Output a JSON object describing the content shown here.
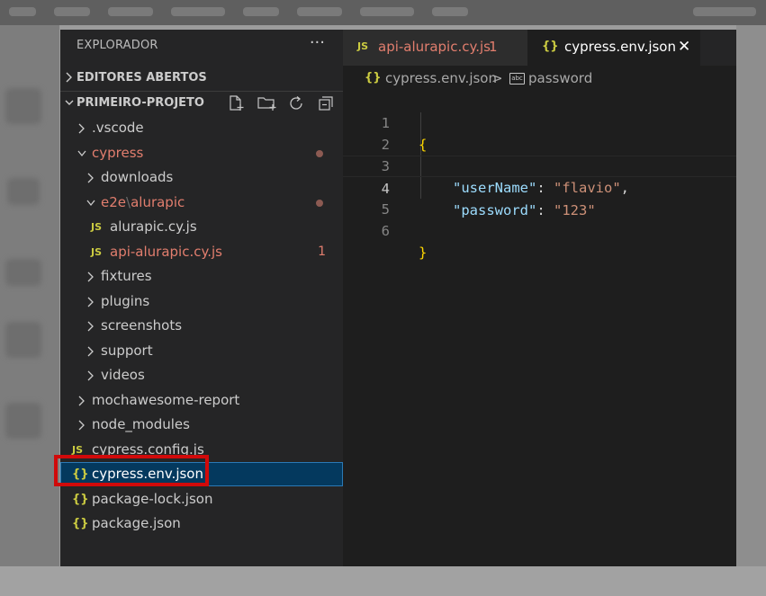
{
  "sidebar": {
    "title": "EXPLORADOR",
    "more_icon": "ellipsis-icon",
    "open_editors_label": "EDITORES ABERTOS",
    "project_label": "PRIMEIRO-PROJETO",
    "toolbar_icons": [
      "new-file-icon",
      "new-folder-icon",
      "refresh-icon",
      "collapse-all-icon"
    ],
    "tree": [
      {
        "label": ".vscode",
        "type": "folder"
      },
      {
        "label": "cypress",
        "type": "folder",
        "modified": true
      },
      {
        "label": "downloads",
        "type": "folder"
      },
      {
        "label": "e2e",
        "label2": "alurapic",
        "sep": "\\",
        "type": "folder",
        "modified": true
      },
      {
        "label": "alurapic.cy.js",
        "type": "js",
        "icon": "JS"
      },
      {
        "label": "api-alurapic.cy.js",
        "type": "js",
        "icon": "JS",
        "badge": "1"
      },
      {
        "label": "fixtures",
        "type": "folder"
      },
      {
        "label": "plugins",
        "type": "folder"
      },
      {
        "label": "screenshots",
        "type": "folder"
      },
      {
        "label": "support",
        "type": "folder"
      },
      {
        "label": "videos",
        "type": "folder"
      },
      {
        "label": "mochawesome-report",
        "type": "folder"
      },
      {
        "label": "node_modules",
        "type": "folder"
      },
      {
        "label": "cypress.config.js",
        "type": "js",
        "icon": "JS"
      },
      {
        "label": "cypress.env.json",
        "type": "json",
        "icon": "{}",
        "selected": true
      },
      {
        "label": "package-lock.json",
        "type": "json",
        "icon": "{}"
      },
      {
        "label": "package.json",
        "type": "json",
        "icon": "{}"
      }
    ]
  },
  "tabs": [
    {
      "icon": "JS",
      "label": "api-alurapic.cy.js",
      "count": "1"
    },
    {
      "icon": "{}",
      "label": "cypress.env.json",
      "close": "✕"
    }
  ],
  "breadcrumb": {
    "icon": "{}",
    "file": "cypress.env.json",
    "separator": ">",
    "symbol_icon": "abc",
    "symbol": "password"
  },
  "code": {
    "line_numbers": [
      "1",
      "2",
      "3",
      "4",
      "5",
      "6"
    ],
    "open_brace": "{",
    "close_brace": "}",
    "key1": "\"userName\"",
    "val1": "\"flavio\"",
    "key2": "\"password\"",
    "val2": "\"123\"",
    "colon": ": ",
    "comma": ","
  },
  "colors": {
    "editor_bg": "#1e1e1e",
    "sidebar_bg": "#252526",
    "selection": "#04395e",
    "modified": "#e27e6e",
    "json_key": "#9cdcfe",
    "json_string": "#ce9178",
    "brace": "#ffd700",
    "highlight": "#d10a0a"
  }
}
